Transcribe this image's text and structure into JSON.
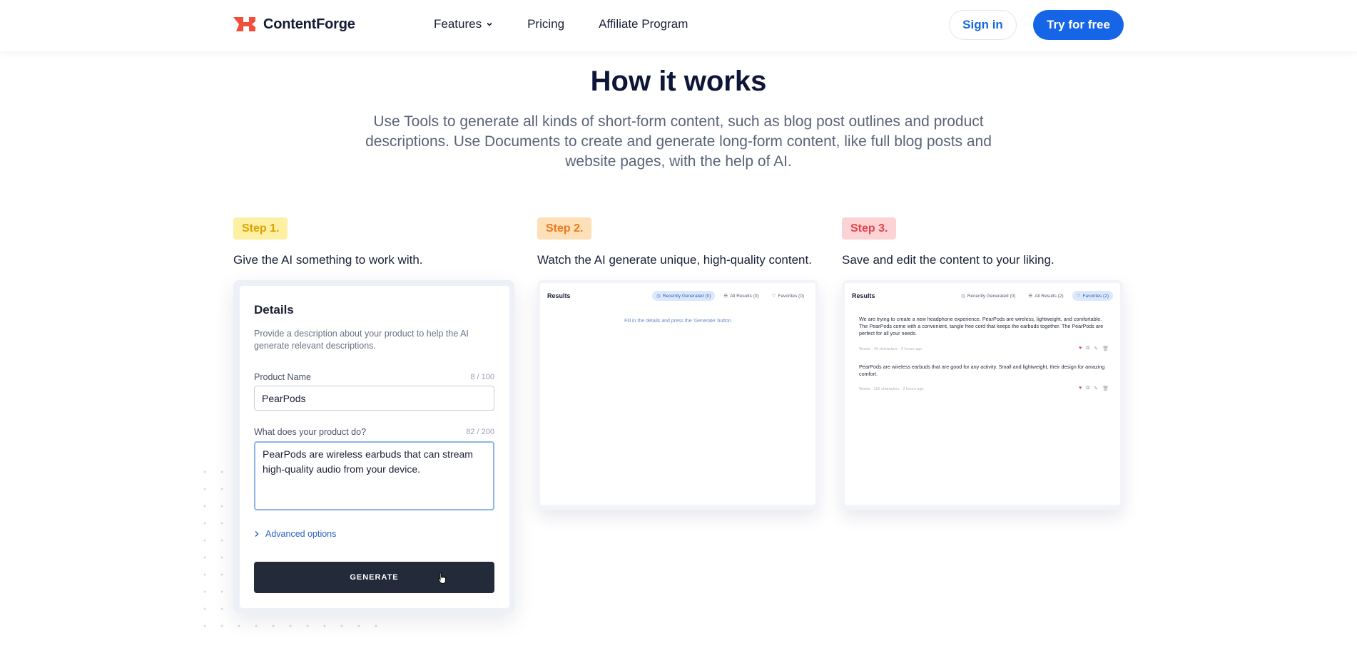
{
  "header": {
    "logo_text": "ContentForge",
    "nav": [
      {
        "label": "Features"
      },
      {
        "label": "Pricing"
      },
      {
        "label": "Affiliate Program"
      }
    ],
    "signin_label": "Sign in",
    "try_label": "Try for free"
  },
  "hero": {
    "title": "How it works",
    "subtitle": "Use Tools to generate all kinds of short-form content, such as blog post outlines and product descriptions. Use Documents to create and generate long-form content, like full blog posts and website pages, with the help of AI."
  },
  "steps": [
    {
      "badge": "Step 1.",
      "desc": "Give the AI something to work with."
    },
    {
      "badge": "Step 2.",
      "desc": "Watch the AI generate unique, high-quality content."
    },
    {
      "badge": "Step 3.",
      "desc": "Save and edit the content to your liking."
    }
  ],
  "form": {
    "title": "Details",
    "description": "Provide a description about your product to help the AI generate relevant descriptions.",
    "product_name_label": "Product Name",
    "product_name_count": "8 / 100",
    "product_name_value": "PearPods",
    "product_does_label": "What does your product do?",
    "product_does_count": "82 / 200",
    "product_does_value": "PearPods are wireless earbuds that can stream high-quality audio from your device.",
    "advanced_label": "Advanced options",
    "generate_label": "GENERATE"
  },
  "results_step2": {
    "label": "Results",
    "tabs": [
      "Recently Generated (0)",
      "All Results (0)",
      "Favorites (0)"
    ],
    "empty": "Fill in the details and press the 'Generate' button"
  },
  "results_step3": {
    "label": "Results",
    "tabs": [
      "Recently Generated (0)",
      "All Results (2)",
      "Favorites (2)"
    ],
    "items": [
      {
        "text": "We are trying to create a new headphone experience. PearPods are wireless, lightweight, and comfortable. The PearPods come with a convenient, tangle free cord that keeps the earbuds together. The PearPods are perfect for all your needs.",
        "meta": "Words · 40 characters · 2 hours ago"
      },
      {
        "text": "PearPods are wireless earbuds that are good for any activity. Small and lightweight, their design for amazing comfort.",
        "meta": "Words · 115 characters · 2 hours ago"
      }
    ]
  },
  "colors": {
    "brand_blue": "#1665e6",
    "logo_red": "#f0503a",
    "step1": "#fdf0a3",
    "step2": "#fddfb8",
    "step3": "#fcd3d5"
  }
}
